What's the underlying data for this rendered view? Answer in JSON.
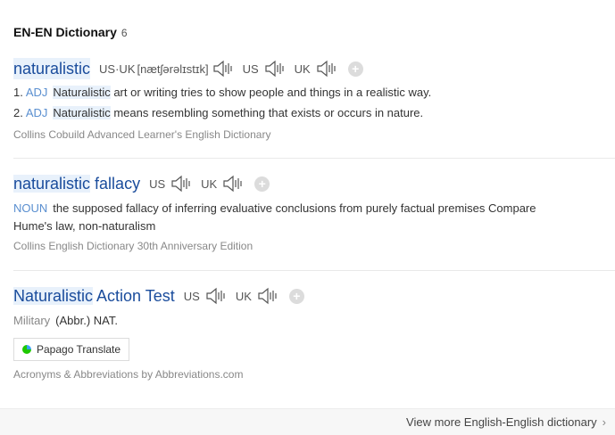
{
  "section": {
    "title": "EN-EN Dictionary",
    "count": "6"
  },
  "entries": [
    {
      "word": "naturalistic",
      "ipa_label": "US·UK",
      "ipa": "[nætʃərəlɪstɪk]",
      "us": "US",
      "uk": "UK",
      "defs": [
        {
          "num": "1.",
          "pos": "ADJ",
          "hl": "Naturalistic",
          "text": " art or writing tries to show people and things in a realistic way."
        },
        {
          "num": "2.",
          "pos": "ADJ",
          "hl": "Naturalistic",
          "text": " means resembling something that exists or occurs in nature."
        }
      ],
      "source": "Collins Cobuild Advanced Learner's English Dictionary"
    },
    {
      "word_hl": "naturalistic",
      "word_rest": " fallacy",
      "us": "US",
      "uk": "UK",
      "pos": "NOUN",
      "def_line1": "the supposed fallacy of inferring evaluative conclusions from purely factual premises Compare",
      "def_line2": "Hume's law, non-naturalism",
      "source": "Collins English Dictionary 30th Anniversary Edition"
    },
    {
      "word_hl": "Naturalistic",
      "word_rest": " Action Test",
      "us": "US",
      "uk": "UK",
      "field": "Military",
      "def": "(Abbr.) NAT.",
      "source": "Acronyms & Abbreviations by Abbreviations.com"
    }
  ],
  "papago_label": "Papago Translate",
  "footer": {
    "more_label": "View more English-English dictionary"
  },
  "colors": {
    "headword": "#1a4c9c",
    "pos": "#5a8fd0",
    "highlight": "#e8f1fb"
  }
}
